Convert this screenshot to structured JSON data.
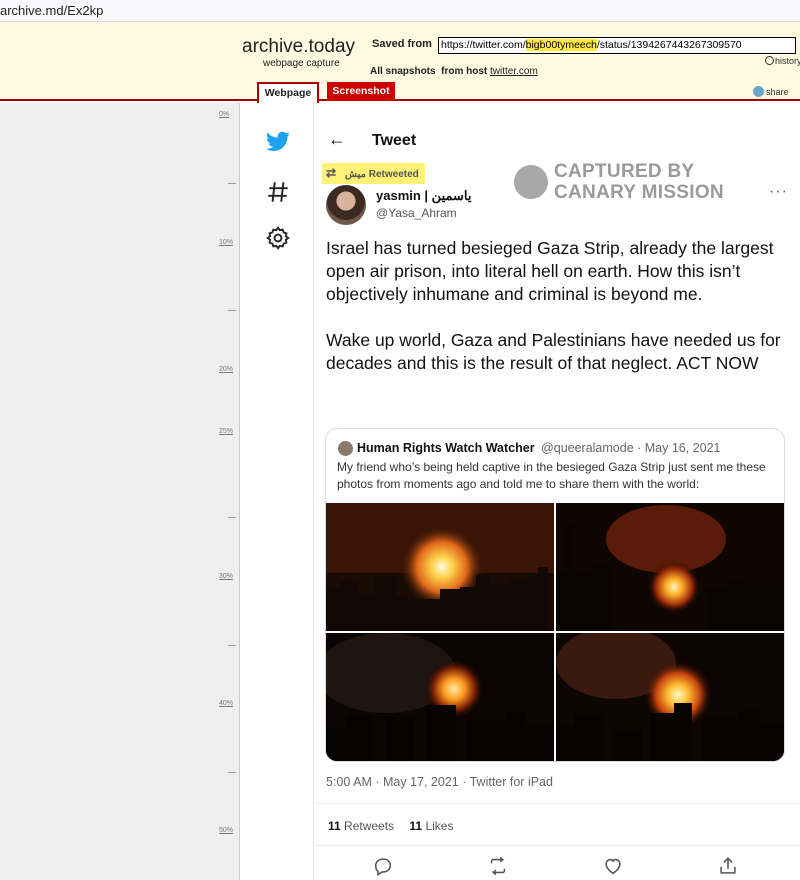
{
  "browser": {
    "url": "archive.md/Ex2kp"
  },
  "archive": {
    "title": "archive.today",
    "subtitle": "webpage capture",
    "saved_from_label": "Saved from",
    "saved_url_pre": "https://twitter.com/",
    "saved_url_highlight": "bigb00tymeech",
    "saved_url_post": "/status/1394267443267309570",
    "history_label": "history",
    "all_snapshots_label": "All snapshots",
    "from_host_label": "from host",
    "host_link": "twitter.com",
    "tab_webpage": "Webpage",
    "tab_screenshot": "Screenshot",
    "share_label": "share",
    "ruler": [
      "0%",
      "10%",
      "20%",
      "25%",
      "30%",
      "40%",
      "50%"
    ]
  },
  "tweet": {
    "header_title": "Tweet",
    "retweeted_by": "ميش",
    "retweeted_label": "Retweeted",
    "watermark_line1": "CAPTURED BY",
    "watermark_line2": "CANARY MISSION",
    "author_name": "yasmin | ياسمين",
    "author_handle": "@Yasa_Ahram",
    "body_p1": "Israel has turned besieged Gaza Strip, already the largest open air prison, into literal hell on earth. How this isn’t objectively inhumane and criminal is beyond me.",
    "body_p2": "Wake up world, Gaza and Palestinians have needed us for decades and this is the result of that neglect. ACT NOW",
    "quote": {
      "name": "Human Rights Watch Watcher",
      "handle_date": "@queeralamode · May 16, 2021",
      "text": "My friend who’s being held captive in the besieged Gaza Strip just sent me these photos from moments ago and told me to share them with the world:"
    },
    "timestamp": "5:00 AM · May 17, 2021 · Twitter for iPad",
    "retweets_count": "11",
    "retweets_label": "Retweets",
    "likes_count": "11",
    "likes_label": "Likes"
  },
  "colors": {
    "archive_red": "#aa0000",
    "highlight": "#fff176",
    "twitter_blue": "#1da1f2"
  }
}
